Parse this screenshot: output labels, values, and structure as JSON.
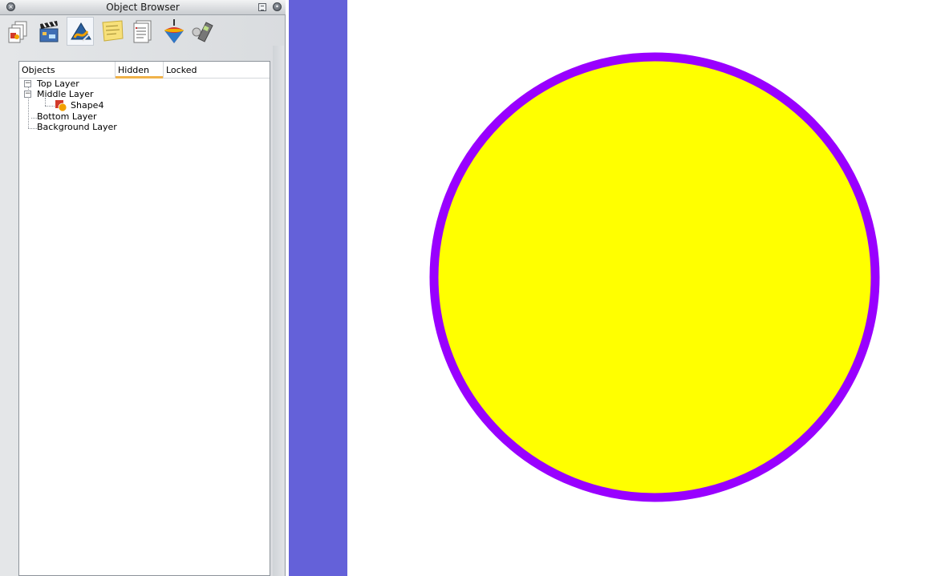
{
  "panel": {
    "title": "Object Browser",
    "toolbar": [
      {
        "name": "pages-tool",
        "icon": "pages-icon",
        "active": false
      },
      {
        "name": "animation-tool",
        "icon": "clapperboard-icon",
        "active": false
      },
      {
        "name": "objects-tool",
        "icon": "objects-icon",
        "active": true
      },
      {
        "name": "notes-tool",
        "icon": "sticky-note-icon",
        "active": false
      },
      {
        "name": "properties-tool",
        "icon": "list-document-icon",
        "active": false
      },
      {
        "name": "spinning-top-tool",
        "icon": "spinning-top-icon",
        "active": false
      },
      {
        "name": "voting-tool",
        "icon": "handset-icon",
        "active": false
      }
    ],
    "columns": [
      "Objects",
      "Hidden",
      "Locked"
    ],
    "tree": {
      "top_layer": "Top Layer",
      "middle_layer": "Middle Layer",
      "shape": "Shape4",
      "bottom_layer": "Bottom Layer",
      "background_layer": "Background Layer"
    }
  },
  "canvas": {
    "pasteboard_color": "#6461d9",
    "shape_fill": "#ffff00",
    "shape_stroke": "#9900ff"
  }
}
